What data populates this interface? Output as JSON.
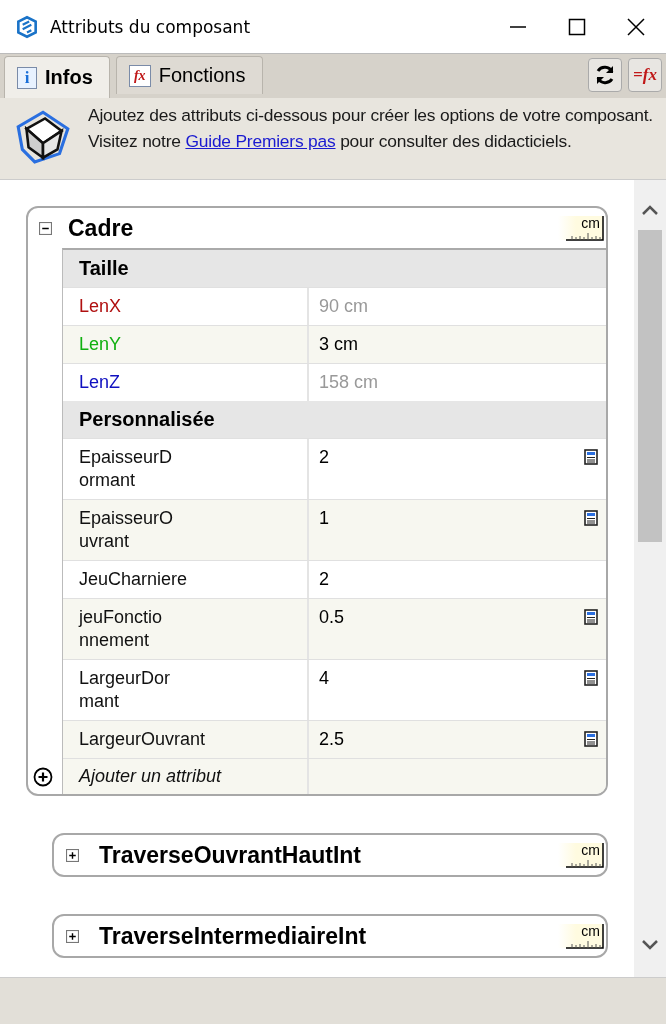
{
  "window": {
    "title": "Attributs du composant"
  },
  "tabs": [
    {
      "label": "Infos",
      "icon_glyph": "i",
      "selected": true
    },
    {
      "label": "Fonctions",
      "icon_glyph": "fx",
      "selected": false
    }
  ],
  "toolbar": {
    "buttons": [
      {
        "kind": "refresh"
      },
      {
        "kind": "formula",
        "label": "=fx"
      }
    ]
  },
  "info": {
    "before": "Ajoutez des attributs ci-dessous pour créer les options de votre composant. Visitez notre ",
    "link": "Guide Premiers pas",
    "after": " pour consulter des didacticiels."
  },
  "panels": [
    {
      "title": "Cadre",
      "unit": "cm",
      "expanded": true,
      "sections": [
        {
          "title": "Taille",
          "rows": [
            {
              "name_lines": [
                "LenX"
              ],
              "value": "90 cm",
              "color": "#b01010",
              "disabled": true,
              "has_formula": false
            },
            {
              "name_lines": [
                "LenY"
              ],
              "value": "3 cm",
              "color": "#10b010",
              "disabled": false,
              "has_formula": false
            },
            {
              "name_lines": [
                "LenZ"
              ],
              "value": "158 cm",
              "color": "#1010c0",
              "disabled": true,
              "has_formula": false
            }
          ]
        },
        {
          "title": "Personnalisée",
          "rows": [
            {
              "name_lines": [
                "EpaisseurD",
                "ormant"
              ],
              "value": "2",
              "disabled": false,
              "has_formula": true
            },
            {
              "name_lines": [
                "EpaisseurO",
                "uvrant"
              ],
              "value": "1",
              "disabled": false,
              "has_formula": true
            },
            {
              "name_lines": [
                "JeuCharniere"
              ],
              "value": "2",
              "disabled": false,
              "has_formula": false
            },
            {
              "name_lines": [
                "jeuFonctio",
                "nnement"
              ],
              "value": "0.5",
              "disabled": false,
              "has_formula": true
            },
            {
              "name_lines": [
                "LargeurDor",
                "mant"
              ],
              "value": "4",
              "disabled": false,
              "has_formula": true
            },
            {
              "name_lines": [
                "LargeurOuvrant"
              ],
              "value": "2.5",
              "disabled": false,
              "has_formula": true
            }
          ]
        }
      ],
      "add_label": "Ajouter un attribut"
    },
    {
      "title": "TraverseOuvrantHautInt",
      "unit": "cm",
      "expanded": false
    },
    {
      "title": "TraverseIntermediaireInt",
      "unit": "cm",
      "expanded": false
    }
  ]
}
